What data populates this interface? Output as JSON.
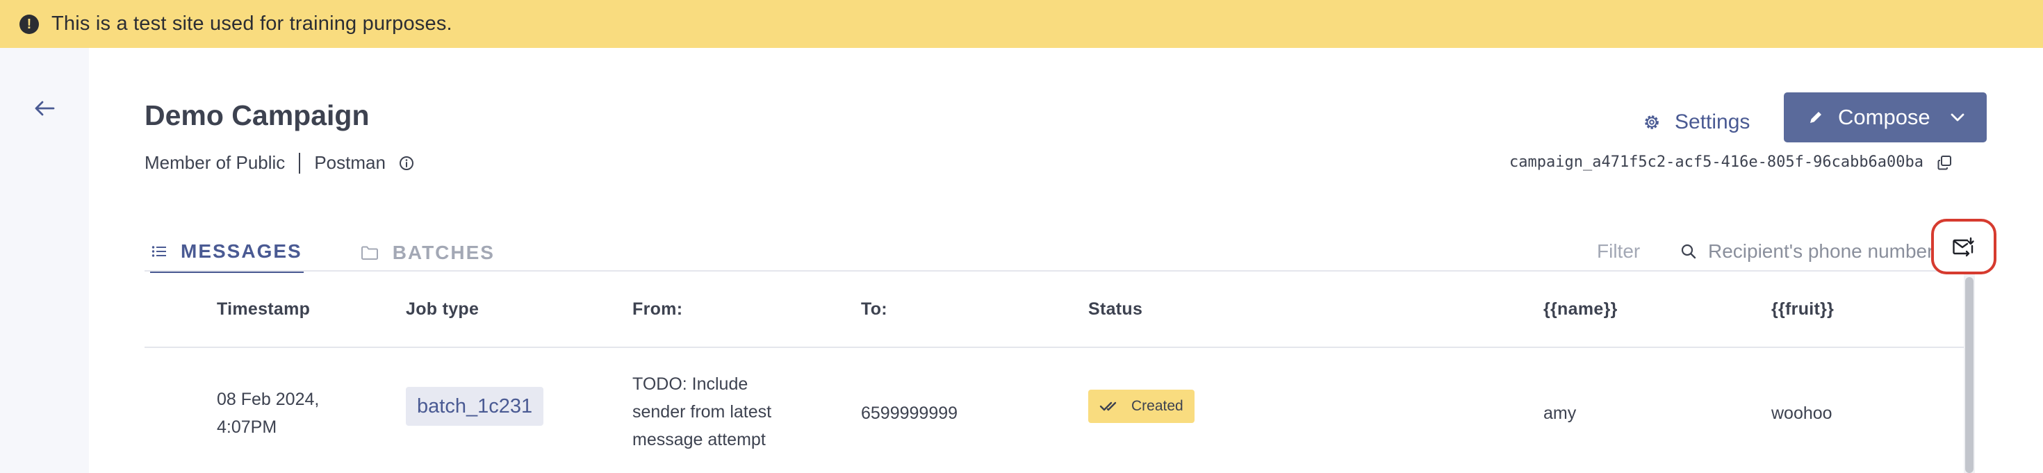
{
  "banner": {
    "icon": "exclamation-circle-icon",
    "text": "This is a test site used for training purposes."
  },
  "nav": {
    "back_icon": "arrow-left-icon"
  },
  "header": {
    "title": "Demo Campaign",
    "role": "Member of Public",
    "channel": "Postman",
    "info_icon": "info-circle-icon",
    "settings_label": "Settings",
    "compose_label": "Compose",
    "campaign_id": "campaign_a471f5c2-acf5-416e-805f-96cabb6a00ba"
  },
  "tabs": [
    {
      "label": "MESSAGES",
      "icon": "list-icon",
      "active": true
    },
    {
      "label": "BATCHES",
      "icon": "folder-icon",
      "active": false
    }
  ],
  "toolbar": {
    "filter_label": "Filter",
    "search_placeholder": "Recipient's phone number",
    "export_icon": "mail-download-icon"
  },
  "table": {
    "headers": [
      "Timestamp",
      "Job type",
      "From:",
      "To:",
      "Status",
      "{{name}}",
      "{{fruit}}"
    ],
    "rows": [
      {
        "timestamp": "08 Feb 2024, 4:07PM",
        "job_type": "batch_1c231",
        "from": "TODO: Include sender from latest message attempt",
        "to": "6599999999",
        "status": "Created",
        "name": "amy",
        "fruit": "woohoo"
      }
    ]
  },
  "colors": {
    "banner_bg": "#f9dc7f",
    "primary": "#5a6a9b",
    "accent_text": "#4a5a93",
    "status_created_bg": "#f9dc7f",
    "highlight_outline": "#d63b2f"
  }
}
